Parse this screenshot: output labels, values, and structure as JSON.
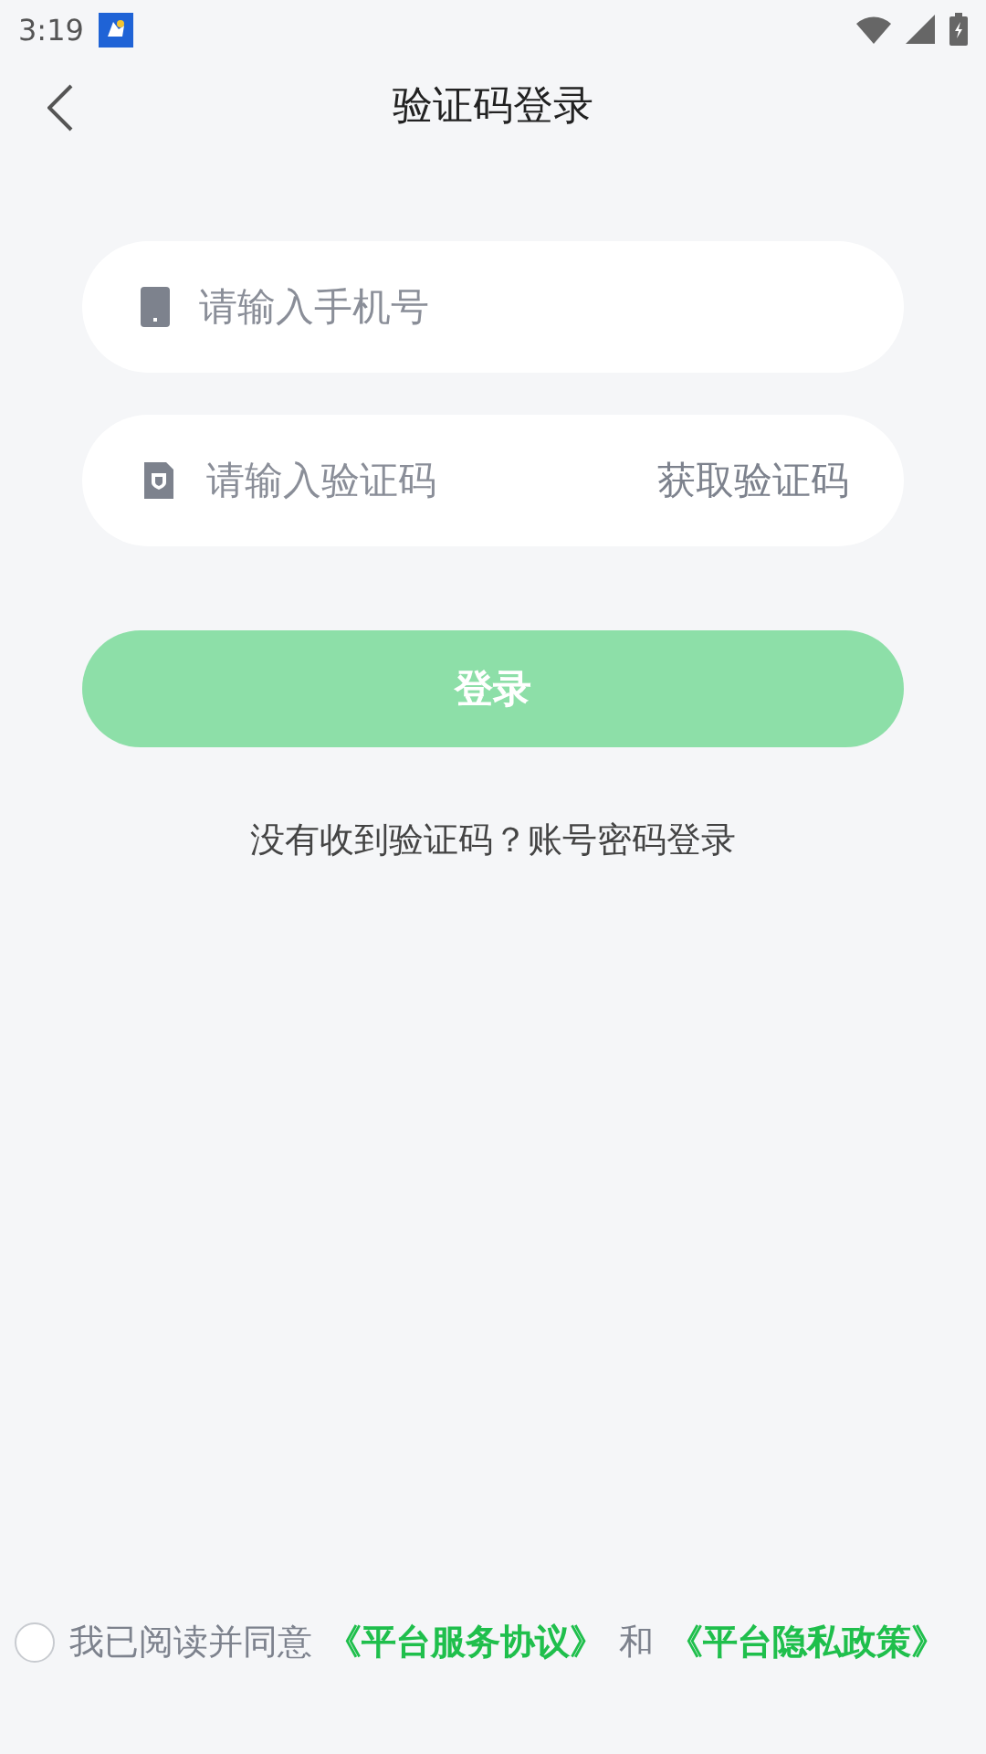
{
  "status_bar": {
    "time": "3:19"
  },
  "header": {
    "title": "验证码登录"
  },
  "fields": [
    {
      "kind": "phone",
      "placeholder": "请输入手机号"
    },
    {
      "kind": "code",
      "placeholder": "请输入验证码",
      "action": "获取验证码"
    }
  ],
  "login_button": {
    "label": "登录",
    "disabled": true
  },
  "alt_login": "没有收到验证码？账号密码登录",
  "agreement": {
    "checked": false,
    "text": "我已阅读并同意",
    "links": [
      "《平台服务协议》",
      "《平台隐私政策》"
    ],
    "joiner": "和"
  }
}
